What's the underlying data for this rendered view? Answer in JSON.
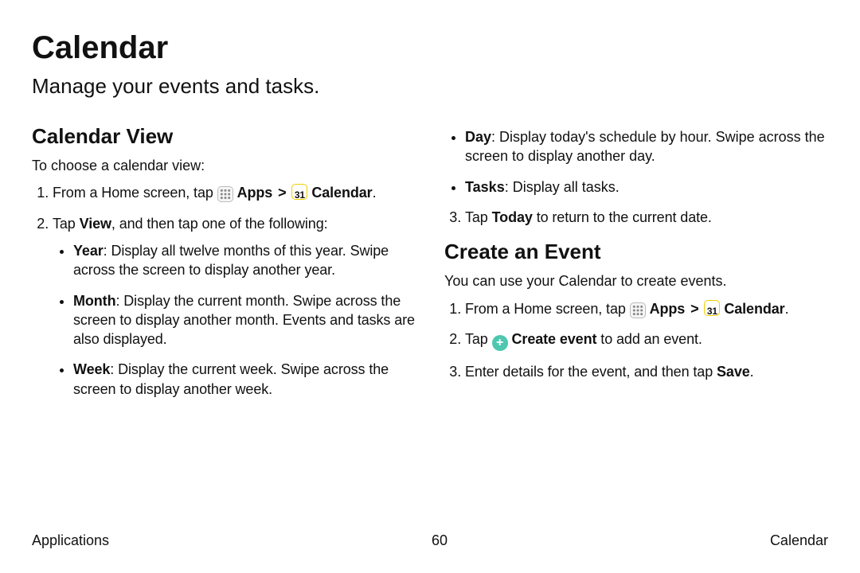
{
  "page": {
    "title": "Calendar",
    "subtitle": "Manage your events and tasks."
  },
  "calendarView": {
    "heading": "Calendar View",
    "intro": "To choose a calendar view:",
    "step1_pre": "From a Home screen, tap ",
    "step1_apps": "Apps",
    "step1_chevron": ">",
    "step1_cal": "Calendar",
    "step1_dot": ".",
    "step2_pre": "Tap ",
    "step2_view": "View",
    "step2_post": ", and then tap one of the following:",
    "year_b": "Year",
    "year_t": ": Display all twelve months of this year. Swipe across the screen to display another year.",
    "month_b": "Month",
    "month_t": ": Display the current month. Swipe across the screen to display another month. Events and tasks are also displayed.",
    "week_b": "Week",
    "week_t": ": Display the current week. Swipe across the screen to display another week.",
    "day_b": "Day",
    "day_t": ": Display today's schedule by hour. Swipe across the screen to display another day.",
    "tasks_b": "Tasks",
    "tasks_t": ": Display all tasks.",
    "step3_pre": "Tap ",
    "step3_today": "Today",
    "step3_post": " to return to the current date."
  },
  "createEvent": {
    "heading": "Create an Event",
    "intro": "You can use your Calendar to create events.",
    "step1_pre": "From a Home screen, tap ",
    "step1_apps": "Apps",
    "step1_chevron": ">",
    "step1_cal": "Calendar",
    "step1_dot": ".",
    "step2_pre": "Tap ",
    "step2_b": "Create event",
    "step2_post": " to add an event.",
    "step3_pre": "Enter details for the event, and then tap ",
    "step3_b": "Save",
    "step3_dot": "."
  },
  "icons": {
    "calendar_value": "31"
  },
  "footer": {
    "left": "Applications",
    "center": "60",
    "right": "Calendar"
  }
}
